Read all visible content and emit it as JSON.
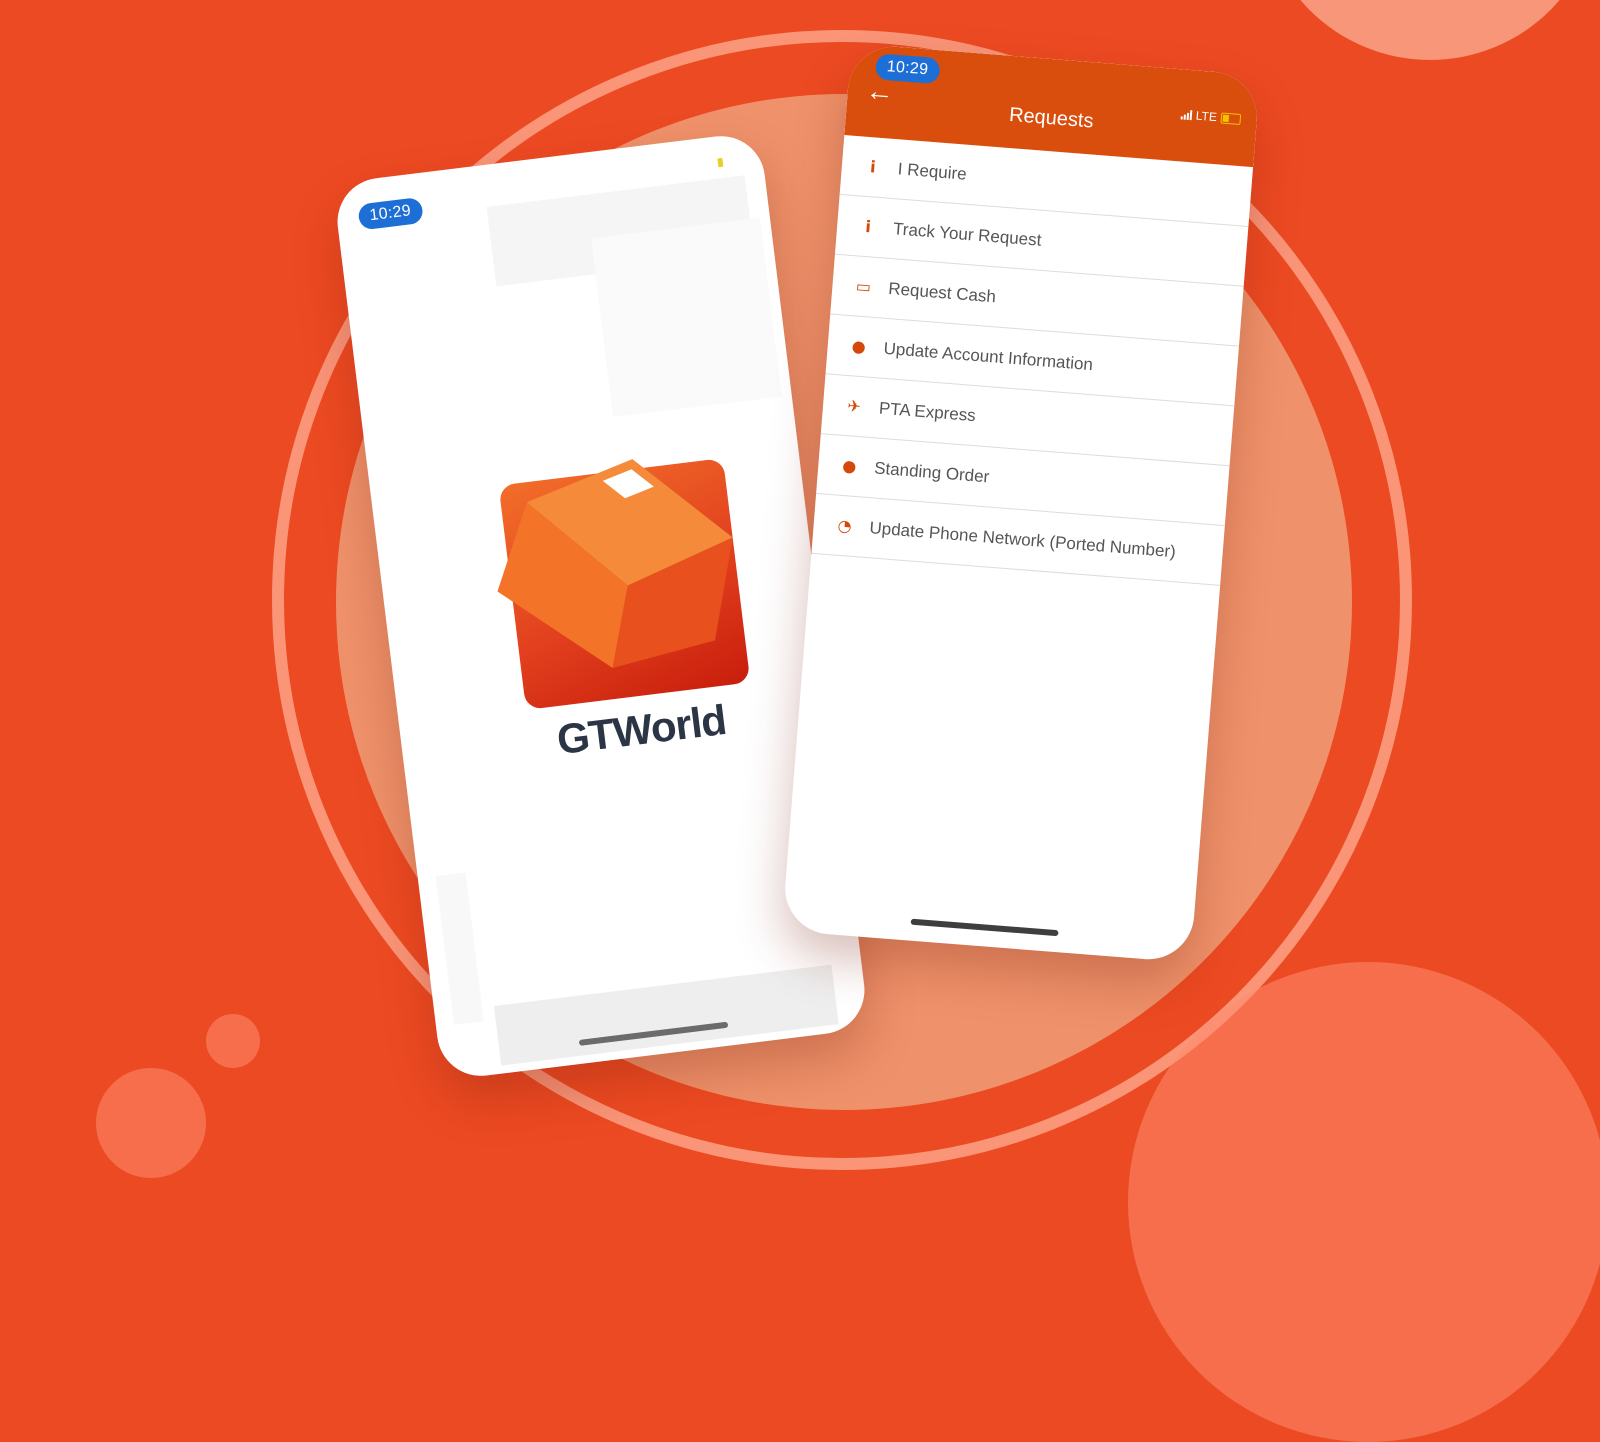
{
  "splash": {
    "status_time": "10:29",
    "app_name": "GTWorld",
    "logo_icon": "gtworld-cube-logo-icon"
  },
  "requests_screen": {
    "status_time": "10:29",
    "network": "LTE",
    "back_icon": "arrow-left-icon",
    "title": "Requests",
    "items": [
      {
        "label": "I Require",
        "icon": "info-icon",
        "glyph": "i"
      },
      {
        "label": "Track Your Request",
        "icon": "info-icon",
        "glyph": "i"
      },
      {
        "label": "Request Cash",
        "icon": "banknote-icon",
        "glyph": "▭"
      },
      {
        "label": "Update Account Information",
        "icon": "user-icon",
        "glyph": "●"
      },
      {
        "label": "PTA Express",
        "icon": "airplane-icon",
        "glyph": "✈"
      },
      {
        "label": "Standing Order",
        "icon": "user-icon",
        "glyph": "●"
      },
      {
        "label": "Update Phone Network (Ported Number)",
        "icon": "rss-icon",
        "glyph": "◔"
      }
    ]
  },
  "colors": {
    "background": "#ec4a22",
    "header": "#d94d0d",
    "accent": "#d4480a",
    "time_pill": "#1d6fd6"
  }
}
